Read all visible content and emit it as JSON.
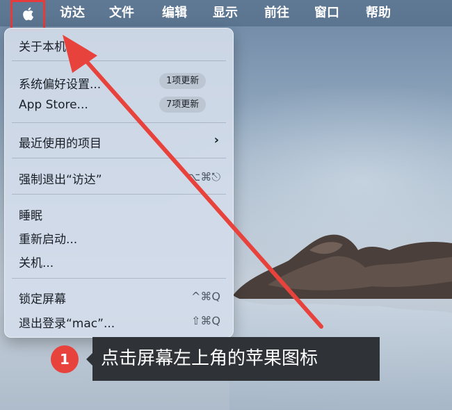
{
  "menubar": {
    "apple_icon": "apple-logo-icon",
    "items": [
      "访达",
      "文件",
      "编辑",
      "显示",
      "前往",
      "窗口",
      "帮助"
    ]
  },
  "apple_menu": {
    "about": "关于本机",
    "system_prefs": "系统偏好设置...",
    "system_prefs_badge": "1项更新",
    "app_store": "App Store...",
    "app_store_badge": "7项更新",
    "recent_items": "最近使用的项目",
    "force_quit": "强制退出“访达”",
    "force_quit_shortcut": "⌥⌘⎋",
    "sleep": "睡眠",
    "restart": "重新启动...",
    "shutdown": "关机...",
    "lock_screen": "锁定屏幕",
    "lock_screen_shortcut": "^⌘Q",
    "logout": "退出登录“mac”...",
    "logout_shortcut": "⇧⌘Q"
  },
  "annotation": {
    "step_number": "1",
    "caption": "点击屏幕左上角的苹果图标",
    "highlight_color": "#e53b3b",
    "arrow_color": "#e8423c"
  }
}
